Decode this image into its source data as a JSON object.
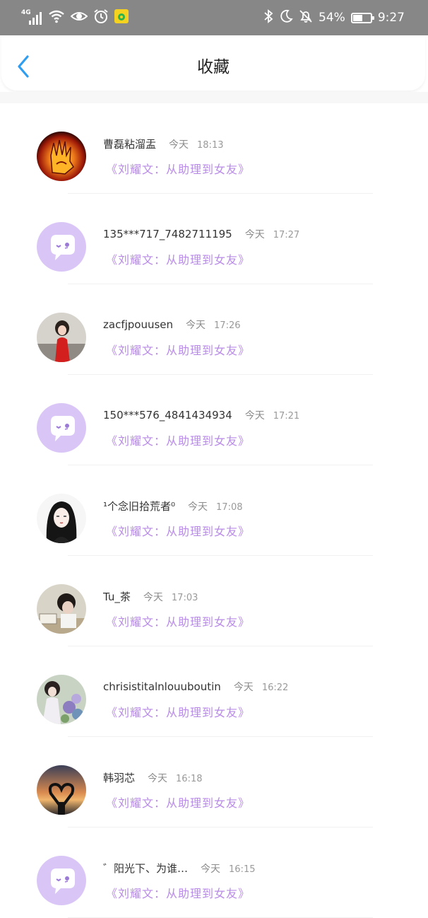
{
  "status_bar": {
    "network": "4G",
    "battery": "54%",
    "battery_level": 0.54,
    "time": "9:27"
  },
  "header": {
    "title": "收藏",
    "back_icon": "chevron-left-icon"
  },
  "colors": {
    "accent_blue": "#2f9df0",
    "book_link": "#b88be6",
    "default_avatar_bg": "#d9c6f7"
  },
  "items": [
    {
      "username": "曹磊粘溜盂",
      "day": "今天",
      "time": "18:13",
      "book": "《刘耀文：从助理到女友》",
      "avatar": "fire-hand-avatar"
    },
    {
      "username": "135***717_7482711195",
      "day": "今天",
      "time": "17:27",
      "book": "《刘耀文：从助理到女友》",
      "avatar": "default-chat-avatar"
    },
    {
      "username": "zacfjpouusen",
      "day": "今天",
      "time": "17:26",
      "book": "《刘耀文：从助理到女友》",
      "avatar": "girl-red-dress-avatar"
    },
    {
      "username": "150***576_4841434934",
      "day": "今天",
      "time": "17:21",
      "book": "《刘耀文：从助理到女友》",
      "avatar": "default-chat-avatar"
    },
    {
      "username": "¹个念旧拾荒者⁰",
      "day": "今天",
      "time": "17:08",
      "book": "《刘耀文：从助理到女友》",
      "avatar": "anime-girl-avatar"
    },
    {
      "username": "Tu_茶",
      "day": "今天",
      "time": "17:03",
      "book": "《刘耀文：从助理到女友》",
      "avatar": "student-desk-avatar"
    },
    {
      "username": "chrisistitalnlouuboutin",
      "day": "今天",
      "time": "16:22",
      "book": "《刘耀文：从助理到女友》",
      "avatar": "flowers-avatar"
    },
    {
      "username": "韩羽芯",
      "day": "今天",
      "time": "16:18",
      "book": "《刘耀文：从助理到女友》",
      "avatar": "sunset-heart-avatar"
    },
    {
      "username": "゛阳光下、为谁…",
      "day": "今天",
      "time": "16:15",
      "book": "《刘耀文：从助理到女友》",
      "avatar": "default-chat-avatar"
    }
  ]
}
